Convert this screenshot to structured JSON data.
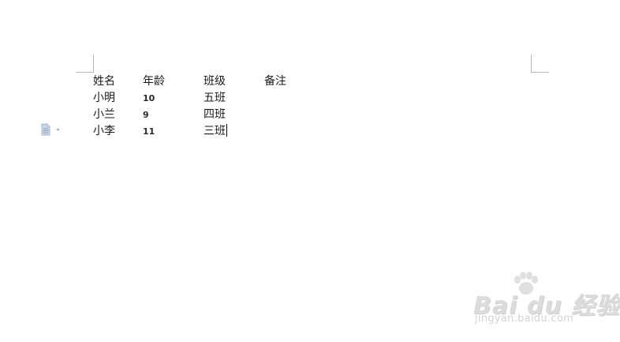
{
  "document": {
    "rows": [
      {
        "name": "姓名",
        "age": "年龄",
        "class": "班级",
        "note": "备注"
      },
      {
        "name": "小明",
        "age": "10",
        "class": "五班",
        "note": ""
      },
      {
        "name": "小兰",
        "age": "9",
        "class": "四班",
        "note": ""
      },
      {
        "name": "小李",
        "age": "11",
        "class": "三班",
        "note": ""
      }
    ]
  },
  "paste_options": {
    "icon": "clipboard-paste-icon",
    "dropdown_icon": "caret-down-icon"
  },
  "watermark": {
    "brand": "Bai du 经验",
    "url": "jingyan.baidu.com",
    "logo_icon": "paw-icon"
  },
  "colors": {
    "text": "#1a1a1a",
    "crop_mark": "#b7b7b7",
    "paste_icon": "#a9b9cf",
    "watermark": "#d9d9d9"
  }
}
